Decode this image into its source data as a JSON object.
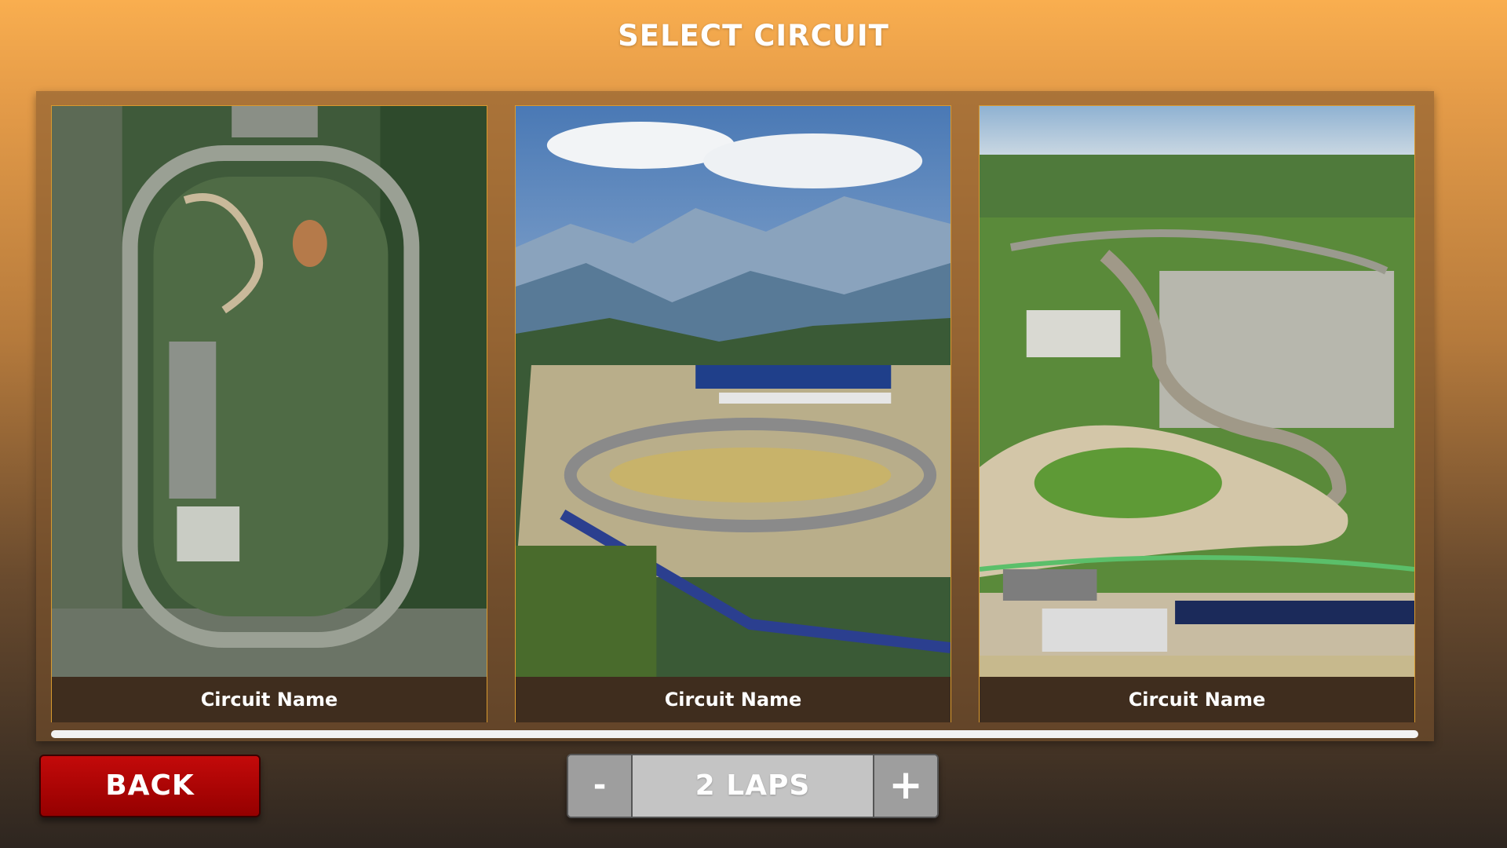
{
  "screen": {
    "title": "SELECT CIRCUIT"
  },
  "circuits": [
    {
      "name": "Circuit Name",
      "image": "oval-speedway-aerial"
    },
    {
      "name": "Circuit Name",
      "image": "mountain-circuit-aerial"
    },
    {
      "name": "Circuit Name",
      "image": "flatland-circuit-aerial"
    }
  ],
  "controls": {
    "back_label": "BACK",
    "laps_label": "2 LAPS",
    "decrease_label": "-",
    "increase_label": "+"
  },
  "colors": {
    "accent_border": "#d99a2e",
    "back_button": "#b30000",
    "card_label_bg": "#3f2d1e"
  }
}
